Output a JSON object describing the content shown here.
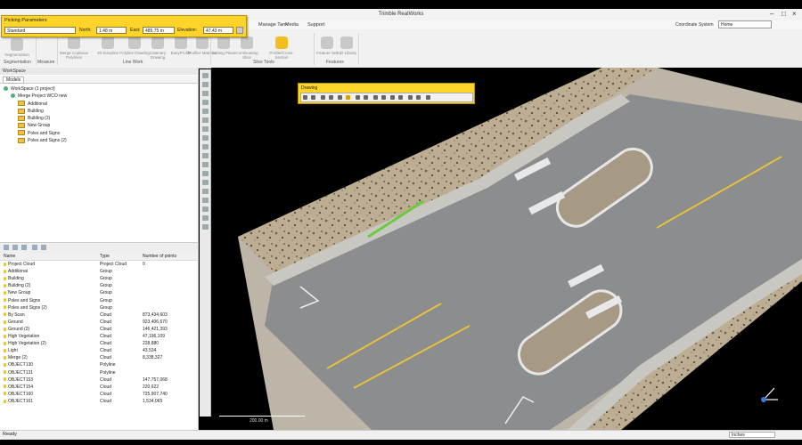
{
  "window": {
    "title": "Trimble RealWorks"
  },
  "ribbon_tabs": [
    "Manage Tank",
    "Media",
    "Support"
  ],
  "coordinate_system": {
    "label": "Coordinate System",
    "value": "Home"
  },
  "ribbon": {
    "groups": [
      "Segmentation",
      "Measure",
      "Line Work",
      "Slice Tools",
      "Features"
    ],
    "buttons": [
      "Segmentation",
      "Merge Coplanar Polylines",
      "2D Easyline",
      "Polyline Drawing",
      "Catenary Drawing",
      "EasyProfile",
      "Profiler Matcher",
      "Cutting Plane",
      "Continuating Slice",
      "Profile/Cross-Section",
      "Feature Set",
      "Edit Library"
    ]
  },
  "picking": {
    "title": "Picking Parameters",
    "mode": "Standard",
    "north_label": "North:",
    "north": "1.48 m",
    "east_label": "East:",
    "east": "485.75 m",
    "elev_label": "Elevation:",
    "elev": "47.43 m"
  },
  "workspace": {
    "header": "WorkSpace",
    "tabs": [
      "Models"
    ],
    "tree": [
      {
        "label": "WorkSpace (1 project)",
        "depth": 0,
        "icon": "globe"
      },
      {
        "label": "Merge Project WCO new",
        "depth": 1,
        "icon": "project"
      },
      {
        "label": "Additional",
        "depth": 2,
        "icon": "folder"
      },
      {
        "label": "Building",
        "depth": 2,
        "icon": "folder"
      },
      {
        "label": "Building (2)",
        "depth": 2,
        "icon": "folder"
      },
      {
        "label": "New Group",
        "depth": 2,
        "icon": "folder"
      },
      {
        "label": "Poles and Signs",
        "depth": 2,
        "icon": "folder"
      },
      {
        "label": "Poles and Signs (2)",
        "depth": 2,
        "icon": "folder"
      }
    ]
  },
  "table": {
    "columns": [
      "Name",
      "Type",
      "Number of points"
    ],
    "rows": [
      [
        "Project Cloud",
        "Project Cloud",
        "0"
      ],
      [
        "Additional",
        "Group",
        ""
      ],
      [
        "Building",
        "Group",
        ""
      ],
      [
        "Building (2)",
        "Group",
        ""
      ],
      [
        "New Group",
        "Group",
        ""
      ],
      [
        "Poles and Signs",
        "Group",
        ""
      ],
      [
        "Poles and Signs (2)",
        "Group",
        ""
      ],
      [
        "By Scan",
        "Cloud",
        "873,434,603"
      ],
      [
        "Ground",
        "Cloud",
        "923,406,670"
      ],
      [
        "Ground (2)",
        "Cloud",
        "146,421,393"
      ],
      [
        "High Vegetation",
        "Cloud",
        "47,196,109"
      ],
      [
        "High Vegetation (2)",
        "Cloud",
        "228,880"
      ],
      [
        "Light",
        "Cloud",
        "43,534"
      ],
      [
        "Merge (2)",
        "Cloud",
        "8,338,327"
      ],
      [
        "OBJECT130",
        "Polyline",
        ""
      ],
      [
        "OBJECT131",
        "Polyline",
        ""
      ],
      [
        "OBJECT153",
        "Cloud",
        "147,757,068"
      ],
      [
        "OBJECT154",
        "Cloud",
        "220,622"
      ],
      [
        "OBJECT160",
        "Cloud",
        "725,907,740"
      ],
      [
        "OBJECT161",
        "Cloud",
        "1,534,065"
      ]
    ]
  },
  "drawing_toolbar": {
    "title": "Drawing"
  },
  "viewport": {
    "scale_label": "200.00 m"
  },
  "status": {
    "text": "Ready",
    "units": "Inches"
  }
}
